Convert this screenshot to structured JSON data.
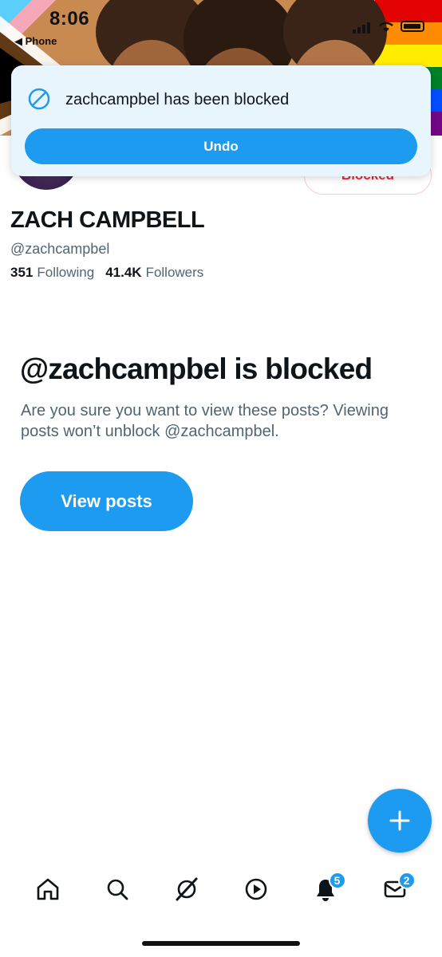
{
  "status_bar": {
    "time": "8:06",
    "back_app": "◀ Phone"
  },
  "toast": {
    "message": "zachcampbel has been blocked",
    "undo_label": "Undo"
  },
  "profile": {
    "blocked_label": "Blocked",
    "display_name": "ZACH CAMPBELL",
    "handle": "@zachcampbel",
    "following_count": "351",
    "following_label": "Following",
    "followers_count": "41.4K",
    "followers_label": "Followers"
  },
  "blocked_notice": {
    "title": "@zachcampbel is blocked",
    "description": "Are you sure you want to view these posts? Viewing posts won’t unblock @zachcampbel.",
    "view_posts_label": "View posts"
  },
  "bottom_nav": {
    "items": [
      {
        "icon": "home-icon"
      },
      {
        "icon": "search-icon"
      },
      {
        "icon": "grok-icon"
      },
      {
        "icon": "video-icon"
      },
      {
        "icon": "notifications-icon",
        "badge": "5"
      },
      {
        "icon": "messages-icon",
        "badge": "2"
      }
    ]
  },
  "colors": {
    "accent": "#1d9bf0",
    "blocked_red": "#f4212e",
    "toast_bg": "#e8f5fd",
    "secondary_text": "#536471"
  }
}
